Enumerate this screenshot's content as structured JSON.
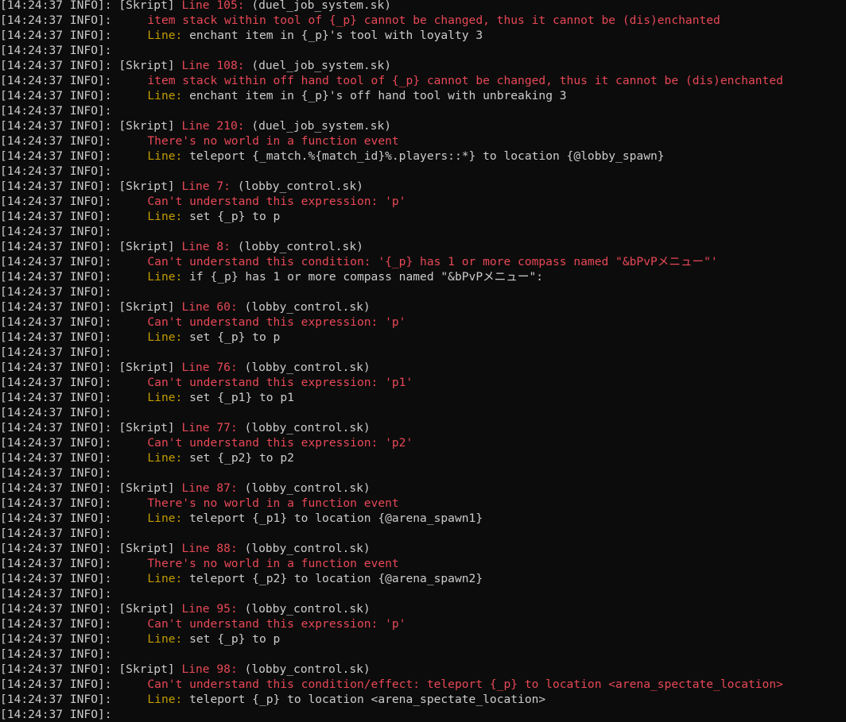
{
  "log": {
    "prefix": "[14:24:37 INFO]: ",
    "rows": [
      {
        "kind": "header",
        "tag": "[Skript] ",
        "line": "Line 105:",
        "file": " (duel_job_system.sk)"
      },
      {
        "kind": "error",
        "text": "item stack within tool of {_p} cannot be changed, thus it cannot be (dis)enchanted"
      },
      {
        "kind": "code",
        "label": "Line:",
        "code": " enchant item in {_p}'s tool with loyalty 3"
      },
      {
        "kind": "blank"
      },
      {
        "kind": "header",
        "tag": "[Skript] ",
        "line": "Line 108:",
        "file": " (duel_job_system.sk)"
      },
      {
        "kind": "error",
        "text": "item stack within off hand tool of {_p} cannot be changed, thus it cannot be (dis)enchanted"
      },
      {
        "kind": "code",
        "label": "Line:",
        "code": " enchant item in {_p}'s off hand tool with unbreaking 3"
      },
      {
        "kind": "blank"
      },
      {
        "kind": "header",
        "tag": "[Skript] ",
        "line": "Line 210:",
        "file": " (duel_job_system.sk)"
      },
      {
        "kind": "error",
        "text": "There's no world in a function event"
      },
      {
        "kind": "code",
        "label": "Line:",
        "code": " teleport {_match.%{match_id}%.players::*} to location {@lobby_spawn}"
      },
      {
        "kind": "blank"
      },
      {
        "kind": "header",
        "tag": "[Skript] ",
        "line": "Line 7:",
        "file": " (lobby_control.sk)"
      },
      {
        "kind": "error",
        "text": "Can't understand this expression: 'p'"
      },
      {
        "kind": "code",
        "label": "Line:",
        "code": " set {_p} to p"
      },
      {
        "kind": "blank"
      },
      {
        "kind": "header",
        "tag": "[Skript] ",
        "line": "Line 8:",
        "file": " (lobby_control.sk)"
      },
      {
        "kind": "error",
        "text": "Can't understand this condition: '{_p} has 1 or more compass named \"&bPvPメニュー\"'"
      },
      {
        "kind": "code",
        "label": "Line:",
        "code": " if {_p} has 1 or more compass named \"&bPvPメニュー\":"
      },
      {
        "kind": "blank"
      },
      {
        "kind": "header",
        "tag": "[Skript] ",
        "line": "Line 60:",
        "file": " (lobby_control.sk)"
      },
      {
        "kind": "error",
        "text": "Can't understand this expression: 'p'"
      },
      {
        "kind": "code",
        "label": "Line:",
        "code": " set {_p} to p"
      },
      {
        "kind": "blank"
      },
      {
        "kind": "header",
        "tag": "[Skript] ",
        "line": "Line 76:",
        "file": " (lobby_control.sk)"
      },
      {
        "kind": "error",
        "text": "Can't understand this expression: 'p1'"
      },
      {
        "kind": "code",
        "label": "Line:",
        "code": " set {_p1} to p1"
      },
      {
        "kind": "blank"
      },
      {
        "kind": "header",
        "tag": "[Skript] ",
        "line": "Line 77:",
        "file": " (lobby_control.sk)"
      },
      {
        "kind": "error",
        "text": "Can't understand this expression: 'p2'"
      },
      {
        "kind": "code",
        "label": "Line:",
        "code": " set {_p2} to p2"
      },
      {
        "kind": "blank"
      },
      {
        "kind": "header",
        "tag": "[Skript] ",
        "line": "Line 87:",
        "file": " (lobby_control.sk)"
      },
      {
        "kind": "error",
        "text": "There's no world in a function event"
      },
      {
        "kind": "code",
        "label": "Line:",
        "code": " teleport {_p1} to location {@arena_spawn1}"
      },
      {
        "kind": "blank"
      },
      {
        "kind": "header",
        "tag": "[Skript] ",
        "line": "Line 88:",
        "file": " (lobby_control.sk)"
      },
      {
        "kind": "error",
        "text": "There's no world in a function event"
      },
      {
        "kind": "code",
        "label": "Line:",
        "code": " teleport {_p2} to location {@arena_spawn2}"
      },
      {
        "kind": "blank"
      },
      {
        "kind": "header",
        "tag": "[Skript] ",
        "line": "Line 95:",
        "file": " (lobby_control.sk)"
      },
      {
        "kind": "error",
        "text": "Can't understand this expression: 'p'"
      },
      {
        "kind": "code",
        "label": "Line:",
        "code": " set {_p} to p"
      },
      {
        "kind": "blank"
      },
      {
        "kind": "header",
        "tag": "[Skript] ",
        "line": "Line 98:",
        "file": " (lobby_control.sk)"
      },
      {
        "kind": "error",
        "text": "Can't understand this condition/effect: teleport {_p} to location <arena_spectate_location>"
      },
      {
        "kind": "code",
        "label": "Line:",
        "code": " teleport {_p} to location <arena_spectate_location>"
      },
      {
        "kind": "blank"
      }
    ]
  },
  "colors": {
    "background": "#0c0c0c",
    "text": "#cccccc",
    "error": "#e74856",
    "label": "#c19c00"
  }
}
